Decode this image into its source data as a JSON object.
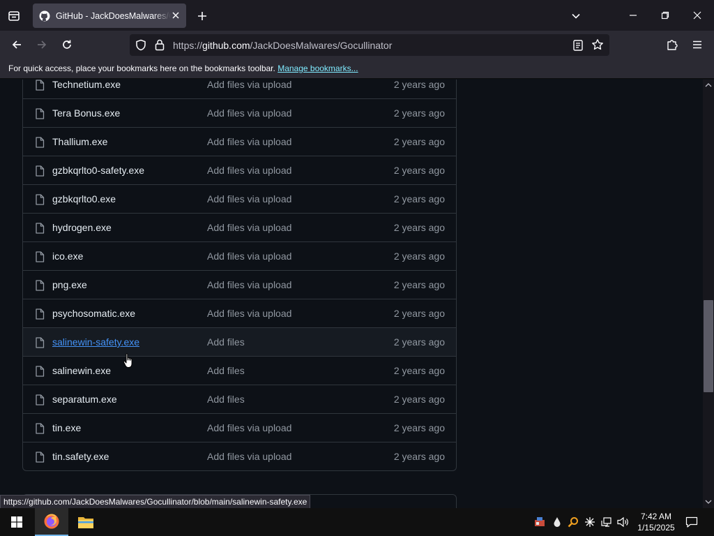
{
  "browser": {
    "tab_title": "GitHub - JackDoesMalwares/Gocullinator",
    "url_prefix": "https://",
    "url_host": "github.com",
    "url_path": "/JackDoesMalwares/Gocullinator",
    "bookmarks_message": "For quick access, place your bookmarks here on the bookmarks toolbar.",
    "bookmarks_link": "Manage bookmarks...",
    "status_url": "https://github.com/JackDoesMalwares/Gocullinator/blob/main/salinewin-safety.exe"
  },
  "files": [
    {
      "name": "Technetium.exe",
      "message": "Add files via upload",
      "date": "2 years ago"
    },
    {
      "name": "Tera Bonus.exe",
      "message": "Add files via upload",
      "date": "2 years ago"
    },
    {
      "name": "Thallium.exe",
      "message": "Add files via upload",
      "date": "2 years ago"
    },
    {
      "name": "gzbkqrlto0-safety.exe",
      "message": "Add files via upload",
      "date": "2 years ago"
    },
    {
      "name": "gzbkqrlto0.exe",
      "message": "Add files via upload",
      "date": "2 years ago"
    },
    {
      "name": "hydrogen.exe",
      "message": "Add files via upload",
      "date": "2 years ago"
    },
    {
      "name": "ico.exe",
      "message": "Add files via upload",
      "date": "2 years ago"
    },
    {
      "name": "png.exe",
      "message": "Add files via upload",
      "date": "2 years ago"
    },
    {
      "name": "psychosomatic.exe",
      "message": "Add files via upload",
      "date": "2 years ago"
    },
    {
      "name": "salinewin-safety.exe",
      "message": "Add files",
      "date": "2 years ago"
    },
    {
      "name": "salinewin.exe",
      "message": "Add files",
      "date": "2 years ago"
    },
    {
      "name": "separatum.exe",
      "message": "Add files",
      "date": "2 years ago"
    },
    {
      "name": "tin.exe",
      "message": "Add files via upload",
      "date": "2 years ago"
    },
    {
      "name": "tin.safety.exe",
      "message": "Add files via upload",
      "date": "2 years ago"
    }
  ],
  "taskbar": {
    "time": "7:42 AM",
    "date": "1/15/2025"
  },
  "colors": {
    "page_bg": "#0d1117",
    "border": "#30363d",
    "link": "#4493f8",
    "text": "#e6edf3",
    "muted": "#9198a1"
  }
}
